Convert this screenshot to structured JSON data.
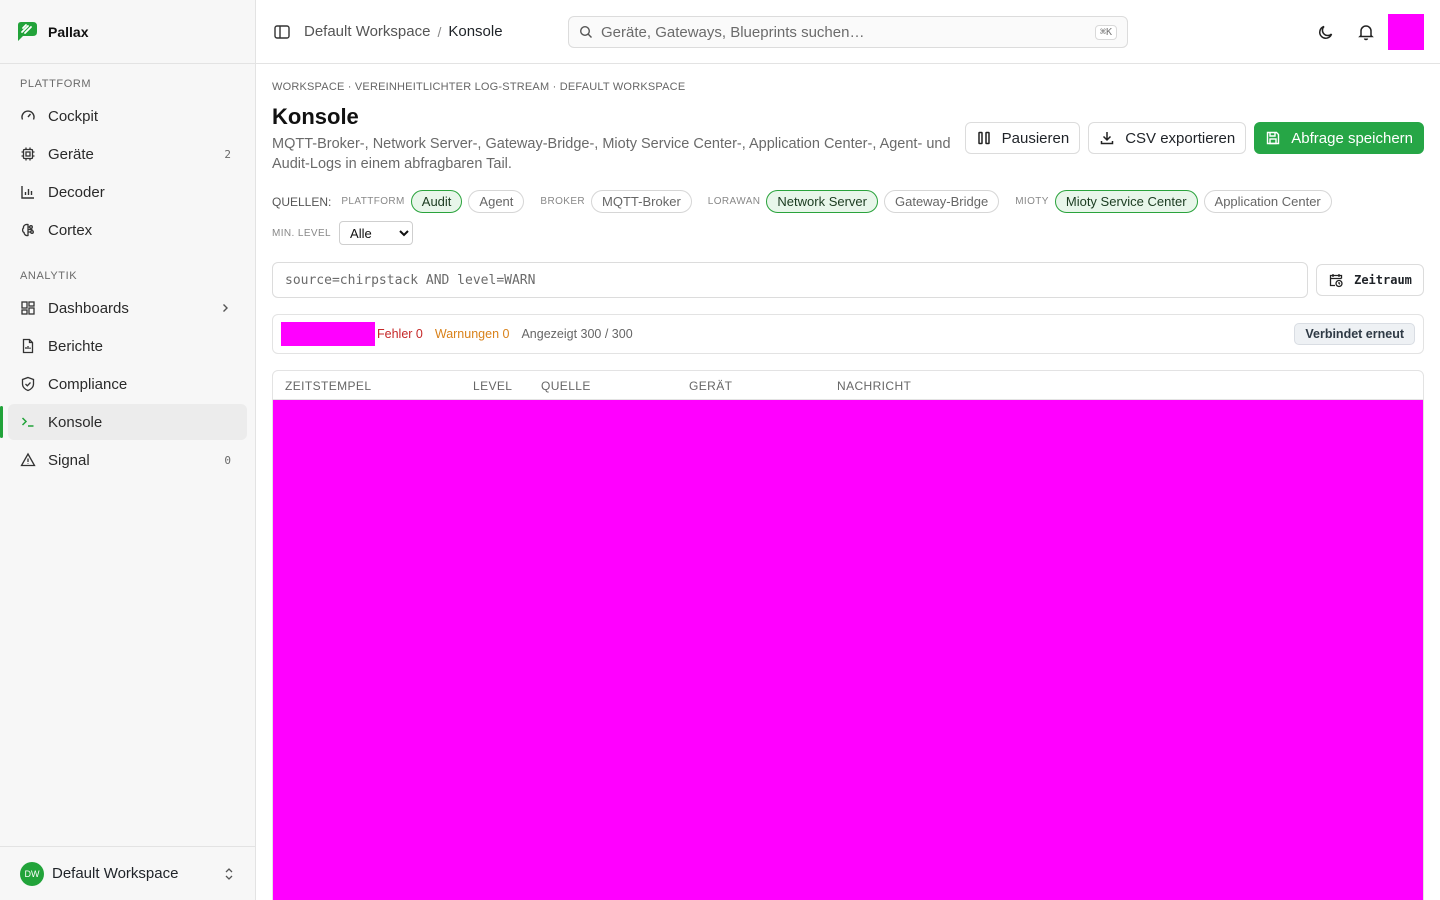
{
  "brand": {
    "name": "Pallax"
  },
  "sidebar": {
    "sections": [
      {
        "label": "PLATTFORM",
        "items": [
          {
            "label": "Cockpit",
            "icon": "gauge-icon"
          },
          {
            "label": "Geräte",
            "icon": "chip-icon",
            "count": "2"
          },
          {
            "label": "Decoder",
            "icon": "bar-chart-icon"
          },
          {
            "label": "Cortex",
            "icon": "brain-icon"
          }
        ]
      },
      {
        "label": "ANALYTIK",
        "items": [
          {
            "label": "Dashboards",
            "icon": "grid-icon"
          },
          {
            "label": "Berichte",
            "icon": "file-icon"
          },
          {
            "label": "Compliance",
            "icon": "shield-icon"
          },
          {
            "label": "Konsole",
            "icon": "terminal-icon",
            "active": true
          },
          {
            "label": "Signal",
            "icon": "warning-icon",
            "count": "0"
          }
        ]
      }
    ],
    "workspace": {
      "initials": "DW",
      "name": "Default Workspace"
    }
  },
  "topbar": {
    "breadcrumb": [
      "Default Workspace",
      "Konsole"
    ],
    "breadcrumb_sep": "/",
    "search_placeholder": "Geräte, Gateways, Blueprints suchen…",
    "search_shortcut": "⌘K"
  },
  "page": {
    "eyebrow": "WORKSPACE · VEREINHEITLICHTER LOG-STREAM · DEFAULT WORKSPACE",
    "title": "Konsole",
    "description": "MQTT-Broker-, Network Server-, Gateway-Bridge-, Mioty Service Center-, Application Center-, Agent- und Audit-Logs in einem abfragbaren Tail.",
    "actions": {
      "pause": "Pausieren",
      "export": "CSV exportieren",
      "save": "Abfrage speichern"
    }
  },
  "filters": {
    "sources_label": "QUELLEN:",
    "groups": [
      {
        "label": "PLATTFORM",
        "chips": [
          {
            "label": "Audit",
            "on": true
          },
          {
            "label": "Agent",
            "on": false
          }
        ]
      },
      {
        "label": "BROKER",
        "chips": [
          {
            "label": "MQTT-Broker",
            "on": false
          }
        ]
      },
      {
        "label": "LORAWAN",
        "chips": [
          {
            "label": "Network Server",
            "on": true
          },
          {
            "label": "Gateway-Bridge",
            "on": false
          }
        ]
      },
      {
        "label": "MIOTY",
        "chips": [
          {
            "label": "Mioty Service Center",
            "on": true
          },
          {
            "label": "Application Center",
            "on": false
          }
        ]
      }
    ],
    "min_level_label": "MIN. LEVEL",
    "min_level_value": "Alle",
    "query_placeholder": "source=chirpstack AND level=WARN",
    "range_label": "Zeitraum"
  },
  "status": {
    "errors": "Fehler 0",
    "warnings": "Warnungen 0",
    "shown": "Angezeigt 300 / 300",
    "connection": "Verbindet erneut"
  },
  "table": {
    "columns": [
      "ZEITSTEMPEL",
      "LEVEL",
      "QUELLE",
      "GERÄT",
      "NACHRICHT"
    ]
  },
  "colors": {
    "accent": "#22a33a",
    "error": "#c62828",
    "warning": "#d9821a",
    "redacted": "#ff00ff"
  }
}
